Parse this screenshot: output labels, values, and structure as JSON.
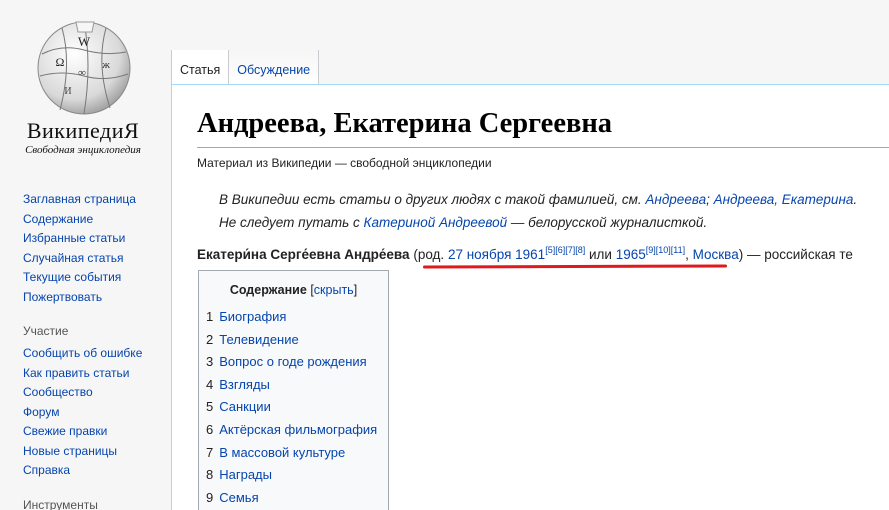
{
  "logo": {
    "wordmark": "ВикипедиЯ",
    "tagline": "Свободная энциклопедия"
  },
  "sidebar": {
    "nav": [
      "Заглавная страница",
      "Содержание",
      "Избранные статьи",
      "Случайная статья",
      "Текущие события",
      "Пожертвовать"
    ],
    "participation_heading": "Участие",
    "participation": [
      "Сообщить об ошибке",
      "Как править статьи",
      "Сообщество",
      "Форум",
      "Свежие правки",
      "Новые страницы",
      "Справка"
    ],
    "tools_heading": "Инструменты"
  },
  "tabs": {
    "article": "Статья",
    "talk": "Обсуждение"
  },
  "page": {
    "title": "Андреева, Екатерина Сергеевна",
    "sitesub": "Материал из Википедии — свободной энциклопедии",
    "hatnote1": {
      "prefix": "В Википедии есть статьи о других людях с такой фамилией, см. ",
      "link1": "Андреева",
      "sep": "; ",
      "link2": "Андреева, Екатерина",
      "suffix": "."
    },
    "hatnote2": {
      "prefix": "Не следует путать с ",
      "link": "Катериной Андреевой",
      "suffix": " — белорусской журналисткой."
    },
    "lead": {
      "name": "Екатери́на Серге́евна Андре́ева",
      "open": " (",
      "rod": "род.",
      "space1": " ",
      "date": "27 ноября 1961",
      "ref1": "[5][6][7][8]",
      "or": " или ",
      "year": "1965",
      "ref2": "[9][10][11]",
      "comma": ", ",
      "city": "Москва",
      "rest": ") — российская те"
    }
  },
  "toc": {
    "title": "Содержание",
    "toggle_open": "[",
    "toggle": "скрыть",
    "toggle_close": "]",
    "items": [
      {
        "num": "1",
        "label": "Биография"
      },
      {
        "num": "2",
        "label": "Телевидение"
      },
      {
        "num": "3",
        "label": "Вопрос о годе рождения"
      },
      {
        "num": "4",
        "label": "Взгляды"
      },
      {
        "num": "5",
        "label": "Санкции"
      },
      {
        "num": "6",
        "label": "Актёрская фильмография"
      },
      {
        "num": "7",
        "label": "В массовой культуре"
      },
      {
        "num": "8",
        "label": "Награды"
      },
      {
        "num": "9",
        "label": "Семья"
      }
    ]
  },
  "colors": {
    "link": "#0645ad",
    "annotation_underline": "#e0191e",
    "content_border": "#a7d7f9"
  }
}
